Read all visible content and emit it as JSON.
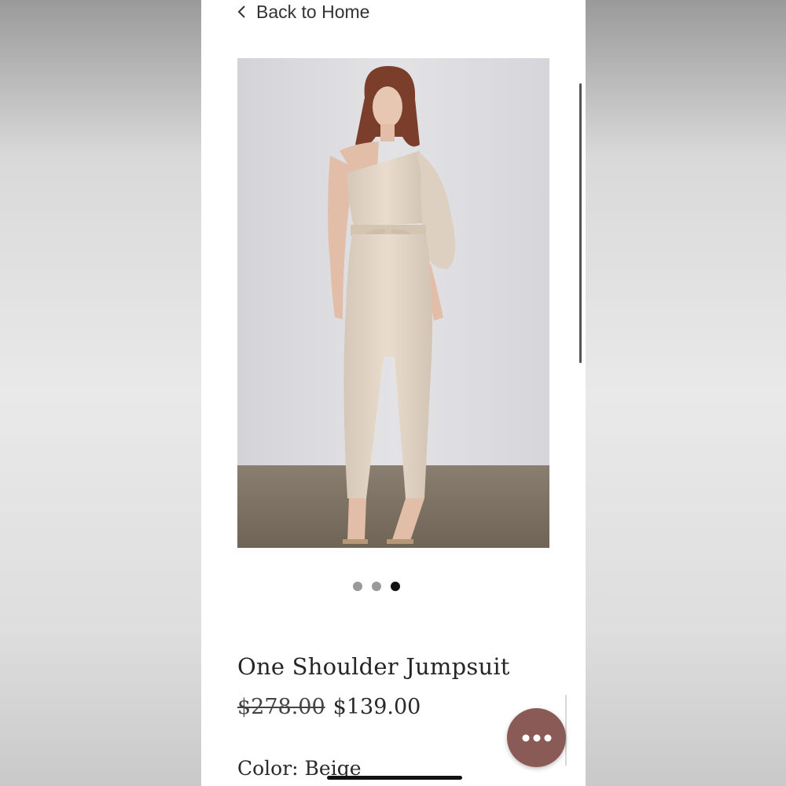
{
  "nav": {
    "back_label": "Back to Home",
    "back_icon": "chevron-left-icon"
  },
  "gallery": {
    "image_alt": "Model wearing the beige one shoulder jumpsuit",
    "slide_count": 3,
    "active_slide_index": 2
  },
  "product": {
    "title": "One Shoulder Jumpsuit",
    "original_price": "$278.00",
    "sale_price": "$139.00",
    "color_label": "Color: Beige"
  },
  "chat_button": {
    "icon": "more-dots-icon",
    "color": "#8a5b56"
  },
  "colors": {
    "background": "#ffffff",
    "text": "#262626",
    "dot_inactive": "#9a9a9a",
    "dot_active": "#111111"
  }
}
